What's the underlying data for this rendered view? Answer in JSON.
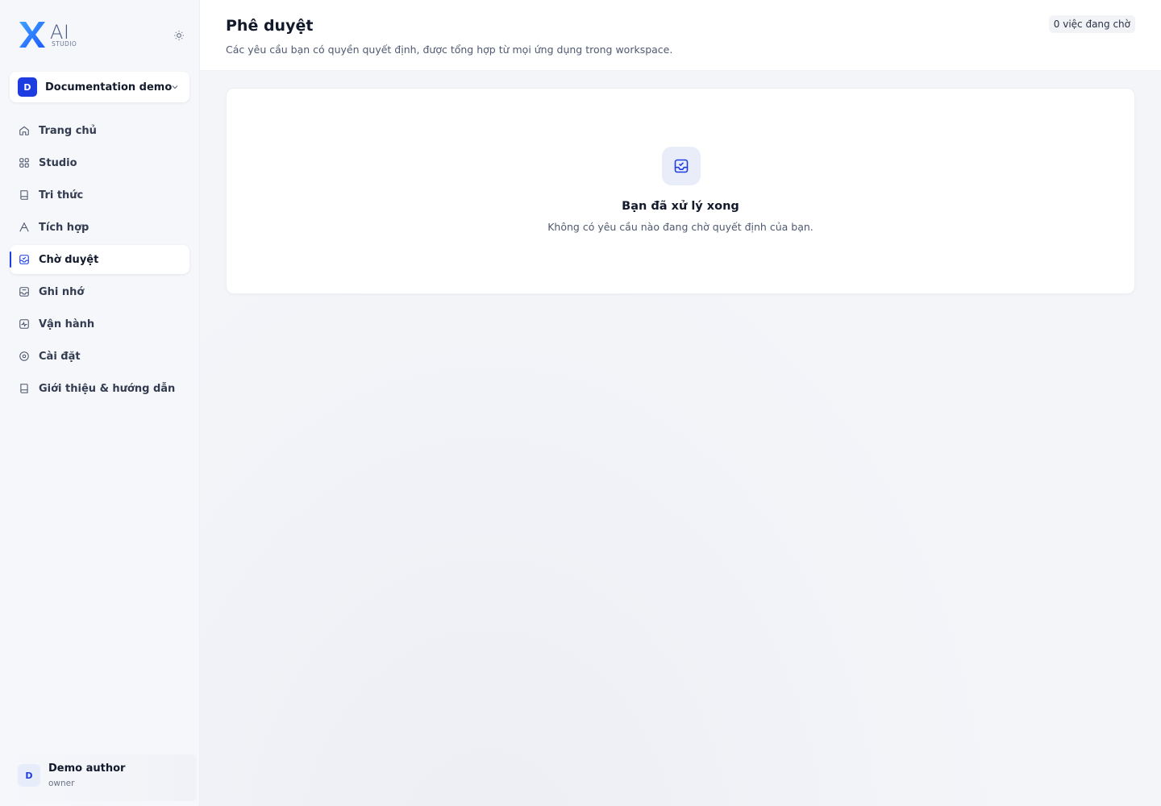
{
  "brand": {
    "logo_text": "AI",
    "logo_subtext": "STUDIO",
    "accent_color": "#1d3de0"
  },
  "workspace": {
    "badge": "D",
    "name": "Documentation demo"
  },
  "nav": [
    {
      "label": "Trang chủ",
      "icon": "home-icon"
    },
    {
      "label": "Studio",
      "icon": "grid-icon"
    },
    {
      "label": "Tri thức",
      "icon": "book-icon"
    },
    {
      "label": "Tích hợp",
      "icon": "integration-icon"
    },
    {
      "label": "Chờ duyệt",
      "icon": "inbox-check-icon",
      "active": true
    },
    {
      "label": "Ghi nhớ",
      "icon": "memory-icon"
    },
    {
      "label": "Vận hành",
      "icon": "activity-icon"
    },
    {
      "label": "Cài đặt",
      "icon": "settings-icon"
    },
    {
      "label": "Giới thiệu & hướng dẫn",
      "icon": "guide-book-icon"
    }
  ],
  "user": {
    "avatar": "D",
    "name": "Demo author",
    "role": "owner"
  },
  "header": {
    "title": "Phê duyệt",
    "subtitle": "Các yêu cầu bạn có quyền quyết định, được tổng hợp từ mọi ứng dụng trong workspace.",
    "pending_badge": "0 việc đang chờ"
  },
  "empty_state": {
    "icon": "inbox-check-icon",
    "title": "Bạn đã xử lý xong",
    "description": "Không có yêu cầu nào đang chờ quyết định của bạn."
  }
}
